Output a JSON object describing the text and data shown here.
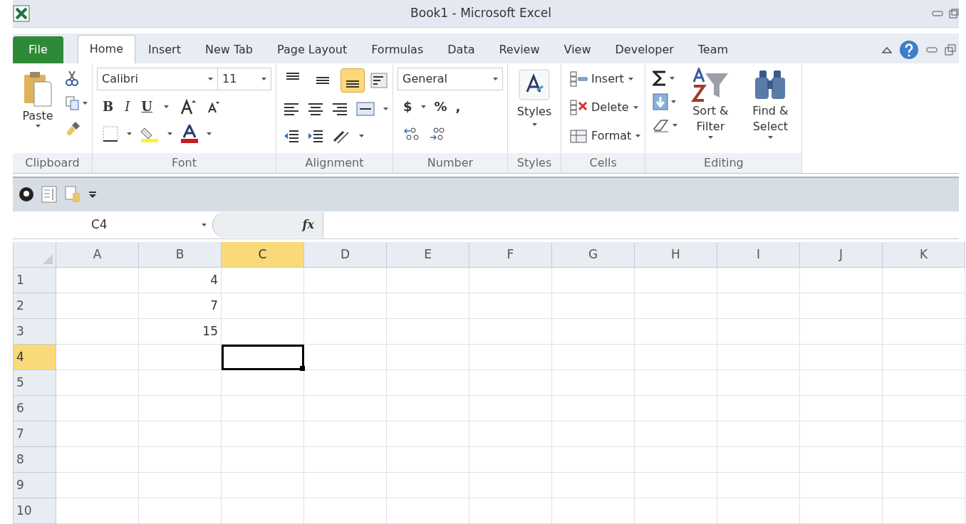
{
  "window": {
    "title": "Book1 - Microsoft Excel"
  },
  "tabs": [
    {
      "label": "File",
      "kind": "file",
      "selected": false
    },
    {
      "label": "Home",
      "kind": "tab",
      "selected": true
    },
    {
      "label": "Insert",
      "kind": "tab",
      "selected": false
    },
    {
      "label": "New Tab",
      "kind": "tab",
      "selected": false
    },
    {
      "label": "Page Layout",
      "kind": "tab",
      "selected": false
    },
    {
      "label": "Formulas",
      "kind": "tab",
      "selected": false
    },
    {
      "label": "Data",
      "kind": "tab",
      "selected": false
    },
    {
      "label": "Review",
      "kind": "tab",
      "selected": false
    },
    {
      "label": "View",
      "kind": "tab",
      "selected": false
    },
    {
      "label": "Developer",
      "kind": "tab",
      "selected": false
    },
    {
      "label": "Team",
      "kind": "tab",
      "selected": false
    }
  ],
  "ribbon": {
    "clipboard": {
      "label": "Clipboard",
      "paste": "Paste"
    },
    "font": {
      "label": "Font",
      "name": "Calibri",
      "size": "11",
      "styles": [
        "B",
        "I",
        "U"
      ]
    },
    "alignment": {
      "label": "Alignment",
      "vertical_align": [
        {
          "selected": false
        },
        {
          "selected": false
        },
        {
          "selected": true
        }
      ]
    },
    "number": {
      "label": "Number",
      "format": "General",
      "symbols": [
        "$",
        "%",
        ","
      ]
    },
    "styles": {
      "label": "Styles",
      "button": "Styles"
    },
    "cells": {
      "label": "Cells",
      "buttons": [
        "Insert",
        "Delete",
        "Format"
      ]
    },
    "editing": {
      "label": "Editing",
      "buttons": [
        "Sort & Filter",
        "Find & Select"
      ]
    }
  },
  "formula_bar": {
    "name_box": "C4",
    "function_label": "fx"
  },
  "sheet": {
    "columns": [
      {
        "label": "A",
        "selected": false
      },
      {
        "label": "B",
        "selected": false
      },
      {
        "label": "C",
        "selected": true
      },
      {
        "label": "D",
        "selected": false
      },
      {
        "label": "E",
        "selected": false
      },
      {
        "label": "F",
        "selected": false
      },
      {
        "label": "G",
        "selected": false
      },
      {
        "label": "H",
        "selected": false
      },
      {
        "label": "I",
        "selected": false
      },
      {
        "label": "J",
        "selected": false
      },
      {
        "label": "K",
        "selected": false
      }
    ],
    "rows": [
      {
        "label": "1",
        "selected": false,
        "column_b": "4"
      },
      {
        "label": "2",
        "selected": false,
        "column_b": "7"
      },
      {
        "label": "3",
        "selected": false,
        "column_b": "15"
      },
      {
        "label": "4",
        "selected": true
      },
      {
        "label": "5",
        "selected": false
      },
      {
        "label": "6",
        "selected": false
      },
      {
        "label": "7",
        "selected": false
      },
      {
        "label": "8",
        "selected": false
      },
      {
        "label": "9",
        "selected": false
      },
      {
        "label": "10",
        "selected": false
      }
    ]
  }
}
